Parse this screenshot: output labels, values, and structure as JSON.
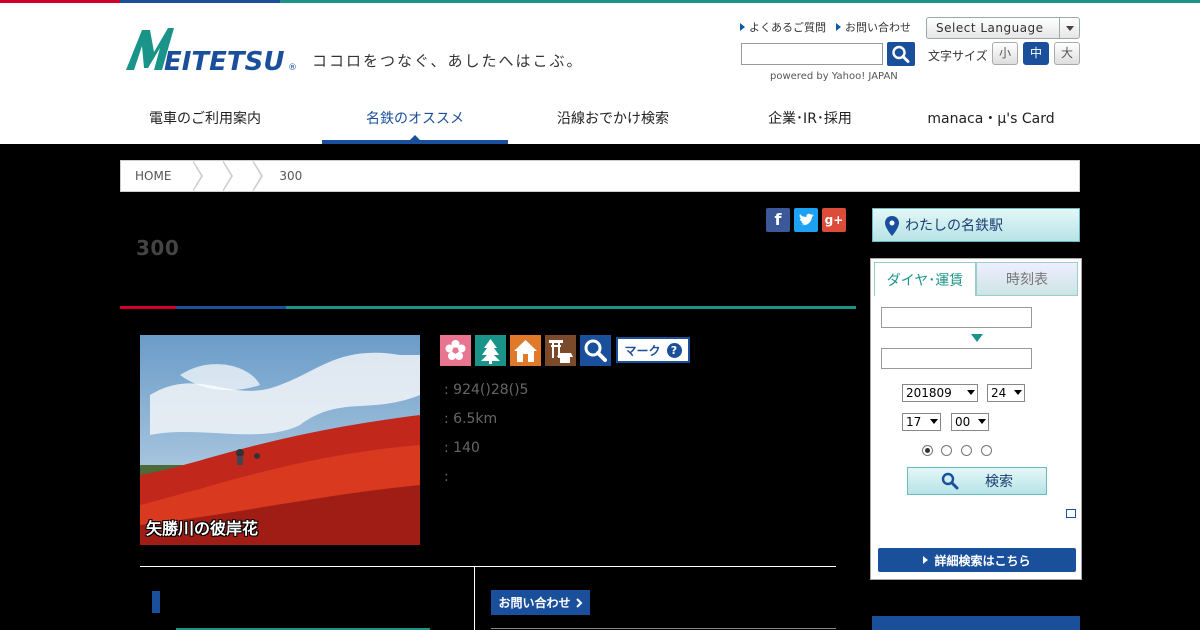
{
  "colors": {
    "brand_blue": "#1a4f9c",
    "accent_teal": "#1a9488",
    "stripe_red": "#d0002b"
  },
  "header": {
    "logo_text": "MEITETSU",
    "tagline": "ココロをつなぐ、あしたへはこぶ。",
    "util_links": [
      "よくあるご質問",
      "お問い合わせ"
    ],
    "language_label": "Select Language",
    "powered_by": "powered by Yahoo! JAPAN",
    "font_size_label": "文字サイズ",
    "font_sizes": [
      "小",
      "中",
      "大"
    ]
  },
  "nav": [
    {
      "label": "電車のご利用案内",
      "active": false
    },
    {
      "label": "名鉄のオススメ",
      "active": true
    },
    {
      "label": "沿線おでかけ検索",
      "active": false
    },
    {
      "label": "企業･IR･採用",
      "active": false
    },
    {
      "label": "manaca・μ's Card",
      "active": false
    }
  ],
  "breadcrumb": [
    "HOME",
    "",
    "",
    "300"
  ],
  "main": {
    "title": "300 ",
    "subtitle": "",
    "photo_caption": "矢勝川の彼岸花",
    "icons": [
      "flower-icon",
      "tree-icon",
      "house-icon",
      "shrine-icon",
      "search-icon"
    ],
    "mark_label": "マーク",
    "info": [
      ": 924()28()5",
      ": 6.5km",
      ": 140",
      ":"
    ],
    "section_heading": "",
    "contact_label": "お問い合わせ"
  },
  "sidebar": {
    "my_station_label": "わたしの名鉄駅",
    "tabs": [
      "ダイヤ･運賃",
      "時刻表"
    ],
    "date_select": "201809",
    "day_select": "24",
    "hour_select": "17",
    "minute_select": "00",
    "search_label": "検索",
    "detail_label": "詳細検索はこちら"
  }
}
